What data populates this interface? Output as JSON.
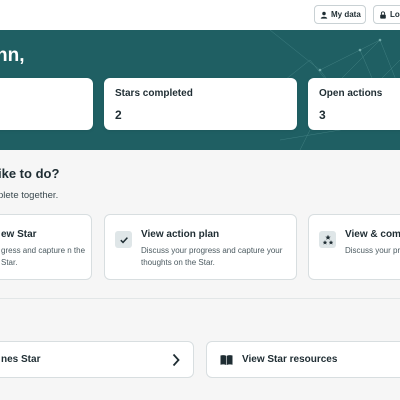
{
  "header": {
    "my_data_label": "My data",
    "logout_label": "Lo"
  },
  "hero": {
    "greeting": "nn,"
  },
  "stats": {
    "stars_completed": {
      "label": "Stars completed",
      "value": "2"
    },
    "open_actions": {
      "label": "Open actions",
      "value": "3"
    }
  },
  "section": {
    "title": "ike to do?",
    "subtitle": "plete together."
  },
  "actions": [
    {
      "title": "ew Star",
      "desc": "gress and capture n the Star.",
      "icon": ""
    },
    {
      "title": "View action plan",
      "desc": "Discuss your progress and capture your thoughts on the Star.",
      "icon": "checkmark-icon"
    },
    {
      "title": "View & com",
      "desc": "Discuss your pr your thoughts",
      "icon": "stars-icon"
    }
  ],
  "links": {
    "star": {
      "label": "nes Star",
      "icon": "chevron-right-icon"
    },
    "resources": {
      "label": "View Star resources",
      "icon": "book-icon"
    }
  },
  "colors": {
    "hero_bg": "#1f5f63",
    "card_bg": "#ffffff",
    "page_bg": "#f6f6f6",
    "text": "#1f2d33"
  }
}
